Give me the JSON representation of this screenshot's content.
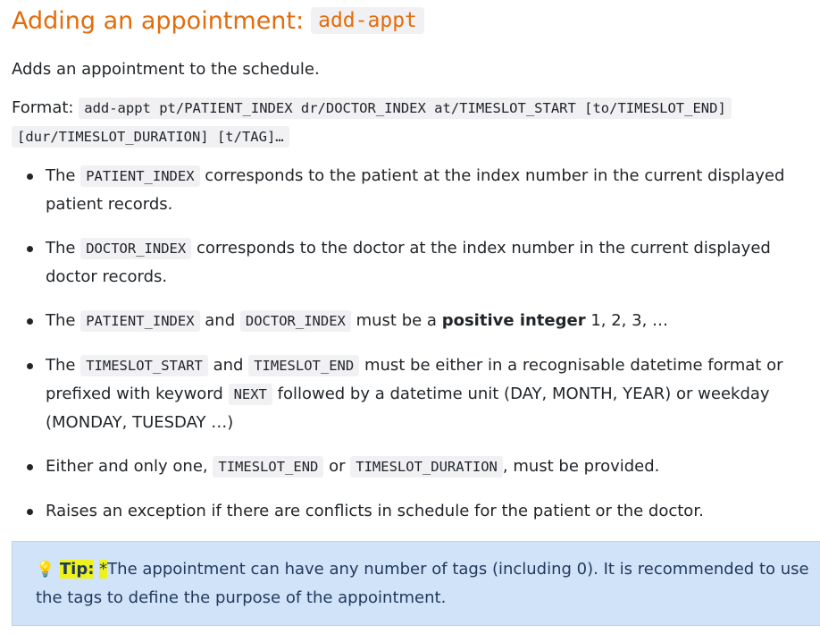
{
  "heading": {
    "text": "Adding an appointment:",
    "command": "add-appt"
  },
  "description": "Adds an appointment to the schedule.",
  "format": {
    "label": "Format:",
    "line1": "add-appt pt/PATIENT_INDEX dr/DOCTOR_INDEX at/TIMESLOT_START [to/TIMESLOT_END]",
    "line2": "[dur/TIMESLOT_DURATION] [t/TAG]…"
  },
  "bullets": {
    "b1": {
      "pre": "The",
      "code": "PATIENT_INDEX",
      "post": "corresponds to the patient at the index number in the current displayed patient records."
    },
    "b2": {
      "pre": "The",
      "code": "DOCTOR_INDEX",
      "post": "corresponds to the doctor at the index number in the current displayed doctor records."
    },
    "b3": {
      "pre": "The",
      "code1": "PATIENT_INDEX",
      "mid": "and",
      "code2": "DOCTOR_INDEX",
      "post1": "must be a",
      "strong": "positive integer",
      "post2": "1, 2, 3, …"
    },
    "b4": {
      "pre": "The",
      "code1": "TIMESLOT_START",
      "mid": "and",
      "code2": "TIMESLOT_END",
      "post1": "must be either in a recognisable datetime format or prefixed with keyword",
      "code3": "NEXT",
      "post2": "followed by a datetime unit (DAY, MONTH, YEAR) or weekday (MONDAY, TUESDAY …)"
    },
    "b5": {
      "pre": "Either and only one,",
      "code1": "TIMESLOT_END",
      "mid": "or",
      "code2": "TIMESLOT_DURATION",
      "post": ", must be provided."
    },
    "b6": {
      "text": "Raises an exception if there are conflicts in schedule for the patient or the doctor."
    }
  },
  "tip": {
    "icon": "lightbulb-icon",
    "label": "Tip:",
    "star": "*",
    "text": "The appointment can have any number of tags (including 0). It is recommended to use the tags to define the purpose of the appointment."
  }
}
